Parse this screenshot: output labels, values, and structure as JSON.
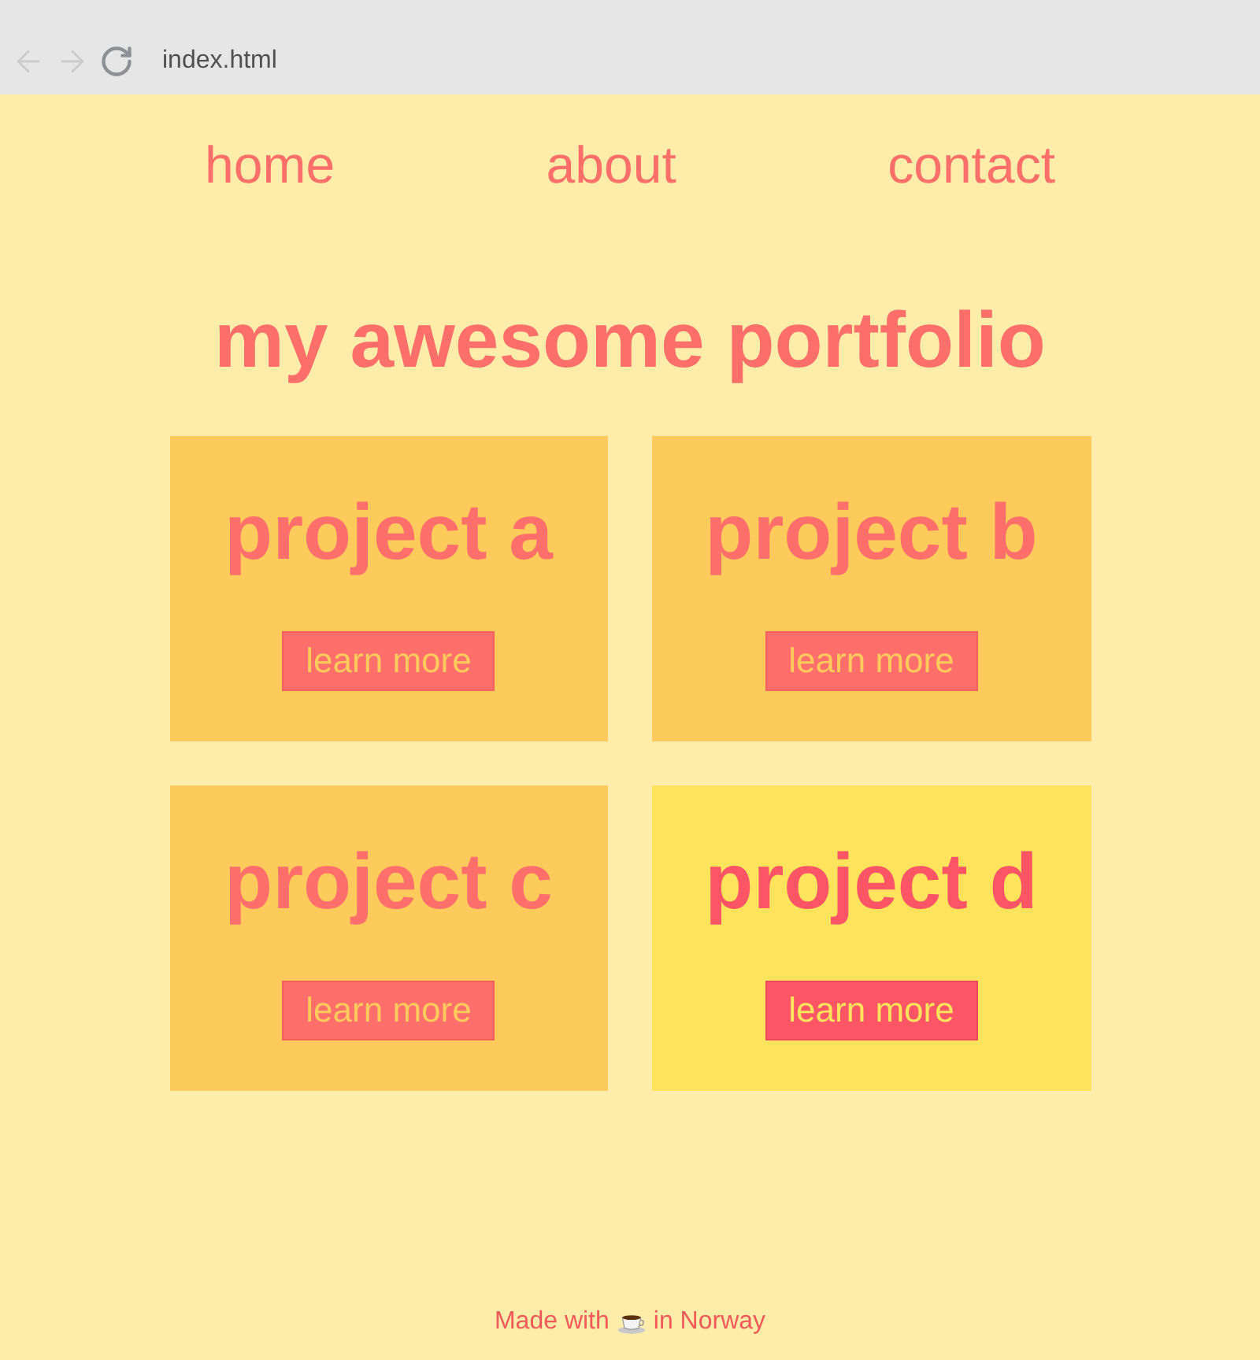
{
  "browser": {
    "address": "index.html",
    "buttons": [
      {
        "kind": "back",
        "disabled": true
      },
      {
        "kind": "forward",
        "disabled": true
      },
      {
        "kind": "reload",
        "disabled": false
      }
    ]
  },
  "nav": [
    {
      "label": "home"
    },
    {
      "label": "about"
    },
    {
      "label": "contact"
    }
  ],
  "title": "my awesome portfolio",
  "projects": [
    {
      "title": "project a",
      "button": "learn more",
      "hovered": false
    },
    {
      "title": "project b",
      "button": "learn more",
      "hovered": false
    },
    {
      "title": "project c",
      "button": "learn more",
      "hovered": false
    },
    {
      "title": "project d",
      "button": "learn more",
      "hovered": true
    }
  ],
  "footer": {
    "before": "Made with",
    "after": "in Norway"
  }
}
